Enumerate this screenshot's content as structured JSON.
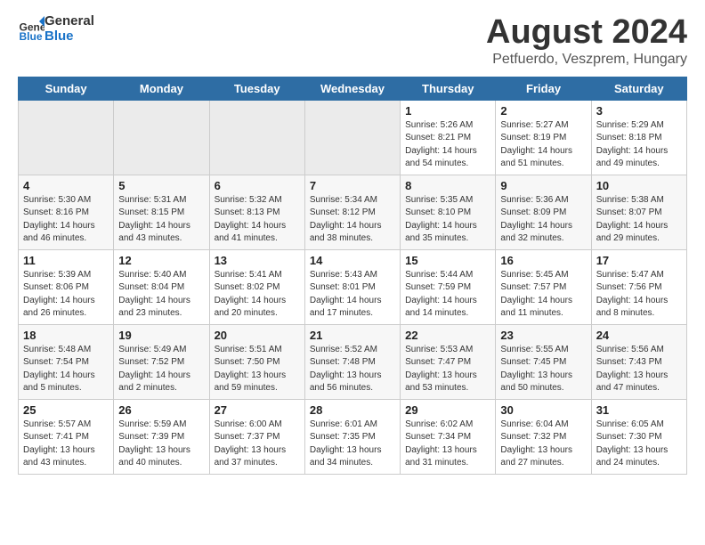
{
  "header": {
    "logo_general": "General",
    "logo_blue": "Blue",
    "month_year": "August 2024",
    "location": "Petfuerdo, Veszprem, Hungary"
  },
  "days_of_week": [
    "Sunday",
    "Monday",
    "Tuesday",
    "Wednesday",
    "Thursday",
    "Friday",
    "Saturday"
  ],
  "weeks": [
    [
      {
        "day": "",
        "empty": true
      },
      {
        "day": "",
        "empty": true
      },
      {
        "day": "",
        "empty": true
      },
      {
        "day": "",
        "empty": true
      },
      {
        "day": "1",
        "sunrise": "5:26 AM",
        "sunset": "8:21 PM",
        "daylight": "14 hours and 54 minutes."
      },
      {
        "day": "2",
        "sunrise": "5:27 AM",
        "sunset": "8:19 PM",
        "daylight": "14 hours and 51 minutes."
      },
      {
        "day": "3",
        "sunrise": "5:29 AM",
        "sunset": "8:18 PM",
        "daylight": "14 hours and 49 minutes."
      }
    ],
    [
      {
        "day": "4",
        "sunrise": "5:30 AM",
        "sunset": "8:16 PM",
        "daylight": "14 hours and 46 minutes."
      },
      {
        "day": "5",
        "sunrise": "5:31 AM",
        "sunset": "8:15 PM",
        "daylight": "14 hours and 43 minutes."
      },
      {
        "day": "6",
        "sunrise": "5:32 AM",
        "sunset": "8:13 PM",
        "daylight": "14 hours and 41 minutes."
      },
      {
        "day": "7",
        "sunrise": "5:34 AM",
        "sunset": "8:12 PM",
        "daylight": "14 hours and 38 minutes."
      },
      {
        "day": "8",
        "sunrise": "5:35 AM",
        "sunset": "8:10 PM",
        "daylight": "14 hours and 35 minutes."
      },
      {
        "day": "9",
        "sunrise": "5:36 AM",
        "sunset": "8:09 PM",
        "daylight": "14 hours and 32 minutes."
      },
      {
        "day": "10",
        "sunrise": "5:38 AM",
        "sunset": "8:07 PM",
        "daylight": "14 hours and 29 minutes."
      }
    ],
    [
      {
        "day": "11",
        "sunrise": "5:39 AM",
        "sunset": "8:06 PM",
        "daylight": "14 hours and 26 minutes."
      },
      {
        "day": "12",
        "sunrise": "5:40 AM",
        "sunset": "8:04 PM",
        "daylight": "14 hours and 23 minutes."
      },
      {
        "day": "13",
        "sunrise": "5:41 AM",
        "sunset": "8:02 PM",
        "daylight": "14 hours and 20 minutes."
      },
      {
        "day": "14",
        "sunrise": "5:43 AM",
        "sunset": "8:01 PM",
        "daylight": "14 hours and 17 minutes."
      },
      {
        "day": "15",
        "sunrise": "5:44 AM",
        "sunset": "7:59 PM",
        "daylight": "14 hours and 14 minutes."
      },
      {
        "day": "16",
        "sunrise": "5:45 AM",
        "sunset": "7:57 PM",
        "daylight": "14 hours and 11 minutes."
      },
      {
        "day": "17",
        "sunrise": "5:47 AM",
        "sunset": "7:56 PM",
        "daylight": "14 hours and 8 minutes."
      }
    ],
    [
      {
        "day": "18",
        "sunrise": "5:48 AM",
        "sunset": "7:54 PM",
        "daylight": "14 hours and 5 minutes."
      },
      {
        "day": "19",
        "sunrise": "5:49 AM",
        "sunset": "7:52 PM",
        "daylight": "14 hours and 2 minutes."
      },
      {
        "day": "20",
        "sunrise": "5:51 AM",
        "sunset": "7:50 PM",
        "daylight": "13 hours and 59 minutes."
      },
      {
        "day": "21",
        "sunrise": "5:52 AM",
        "sunset": "7:48 PM",
        "daylight": "13 hours and 56 minutes."
      },
      {
        "day": "22",
        "sunrise": "5:53 AM",
        "sunset": "7:47 PM",
        "daylight": "13 hours and 53 minutes."
      },
      {
        "day": "23",
        "sunrise": "5:55 AM",
        "sunset": "7:45 PM",
        "daylight": "13 hours and 50 minutes."
      },
      {
        "day": "24",
        "sunrise": "5:56 AM",
        "sunset": "7:43 PM",
        "daylight": "13 hours and 47 minutes."
      }
    ],
    [
      {
        "day": "25",
        "sunrise": "5:57 AM",
        "sunset": "7:41 PM",
        "daylight": "13 hours and 43 minutes."
      },
      {
        "day": "26",
        "sunrise": "5:59 AM",
        "sunset": "7:39 PM",
        "daylight": "13 hours and 40 minutes."
      },
      {
        "day": "27",
        "sunrise": "6:00 AM",
        "sunset": "7:37 PM",
        "daylight": "13 hours and 37 minutes."
      },
      {
        "day": "28",
        "sunrise": "6:01 AM",
        "sunset": "7:35 PM",
        "daylight": "13 hours and 34 minutes."
      },
      {
        "day": "29",
        "sunrise": "6:02 AM",
        "sunset": "7:34 PM",
        "daylight": "13 hours and 31 minutes."
      },
      {
        "day": "30",
        "sunrise": "6:04 AM",
        "sunset": "7:32 PM",
        "daylight": "13 hours and 27 minutes."
      },
      {
        "day": "31",
        "sunrise": "6:05 AM",
        "sunset": "7:30 PM",
        "daylight": "13 hours and 24 minutes."
      }
    ]
  ],
  "labels": {
    "sunrise": "Sunrise:",
    "sunset": "Sunset:",
    "daylight": "Daylight:"
  }
}
